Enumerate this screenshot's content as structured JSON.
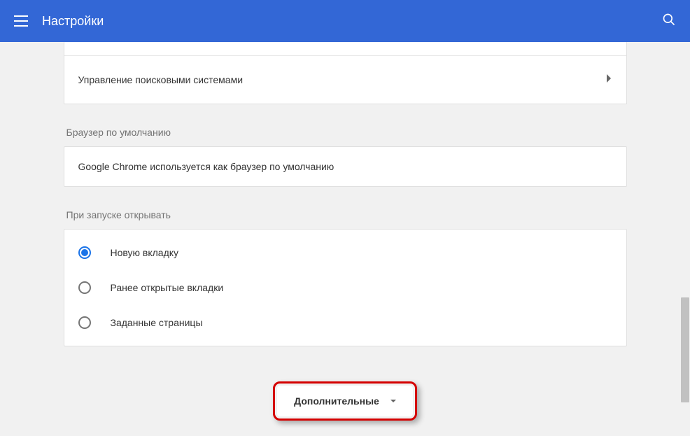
{
  "header": {
    "title": "Настройки"
  },
  "search_engines": {
    "manage_label": "Управление поисковыми системами"
  },
  "default_browser": {
    "section_title": "Браузер по умолчанию",
    "status_text": "Google Chrome используется как браузер по умолчанию"
  },
  "on_startup": {
    "section_title": "При запуске открывать",
    "options": [
      {
        "label": "Новую вкладку",
        "selected": true
      },
      {
        "label": "Ранее открытые вкладки",
        "selected": false
      },
      {
        "label": "Заданные страницы",
        "selected": false
      }
    ]
  },
  "advanced": {
    "label": "Дополнительные"
  }
}
